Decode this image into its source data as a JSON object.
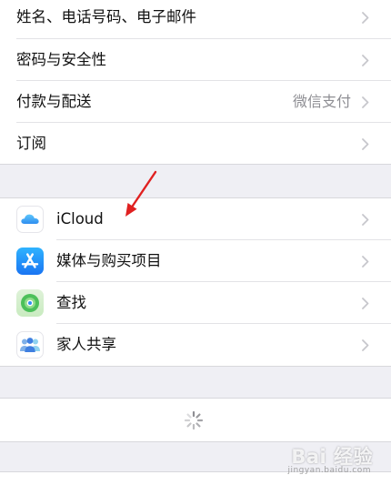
{
  "account_section": {
    "items": [
      {
        "label": "姓名、电话号码、电子邮件"
      },
      {
        "label": "密码与安全性"
      },
      {
        "label": "付款与配送",
        "value": "微信支付"
      },
      {
        "label": "订阅"
      }
    ]
  },
  "services_section": {
    "items": [
      {
        "label": "iCloud",
        "icon": "icloud-icon"
      },
      {
        "label": "媒体与购买项目",
        "icon": "app-store-icon"
      },
      {
        "label": "查找",
        "icon": "find-my-icon"
      },
      {
        "label": "家人共享",
        "icon": "family-sharing-icon"
      }
    ]
  },
  "loading": {
    "icon": "loading-spinner-icon"
  },
  "annotation": {
    "color": "#e02020",
    "icon": "red-arrow-icon"
  },
  "watermark": {
    "text": "Bai 经验",
    "sub": "jingyan.baidu.com"
  },
  "colors": {
    "background": "#efeff4",
    "cell": "#ffffff",
    "secondary_text": "#8e8e93",
    "chevron": "#c7c7cc"
  }
}
